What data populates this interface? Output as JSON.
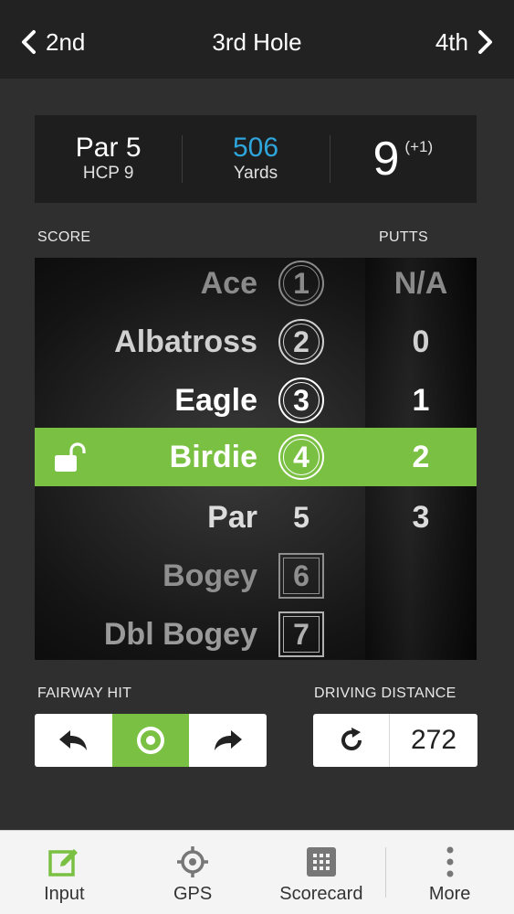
{
  "nav": {
    "prev_label": "2nd",
    "title": "3rd Hole",
    "next_label": "4th"
  },
  "info": {
    "par": "Par 5",
    "hcp": "HCP 9",
    "yards_value": "506",
    "yards_label": "Yards",
    "strokes": "9",
    "strokes_relative": "(+1)"
  },
  "labels": {
    "score": "SCORE",
    "putts": "PUTTS",
    "fairway_hit": "FAIRWAY HIT",
    "driving_distance": "DRIVING DISTANCE"
  },
  "score_rows": [
    {
      "name": "Ace",
      "number": "1",
      "putts": "N/A"
    },
    {
      "name": "Albatross",
      "number": "2",
      "putts": "0"
    },
    {
      "name": "Eagle",
      "number": "3",
      "putts": "1"
    },
    {
      "name": "Birdie",
      "number": "4",
      "putts": "2"
    },
    {
      "name": "Par",
      "number": "5",
      "putts": "3"
    },
    {
      "name": "Bogey",
      "number": "6",
      "putts": ""
    },
    {
      "name": "Dbl Bogey",
      "number": "7",
      "putts": ""
    }
  ],
  "selected_score": "Birdie",
  "fairway": {
    "selected": "hit"
  },
  "driving_distance": {
    "value": "272"
  },
  "tabs": [
    {
      "label": "Input",
      "icon": "edit-icon"
    },
    {
      "label": "GPS",
      "icon": "crosshair-icon"
    },
    {
      "label": "Scorecard",
      "icon": "keypad-icon"
    },
    {
      "label": "More",
      "icon": "more-vertical-icon"
    }
  ],
  "colors": {
    "accent_green": "#7ac043",
    "yards_blue": "#2ea6dc",
    "background": "#2f2f2f"
  }
}
